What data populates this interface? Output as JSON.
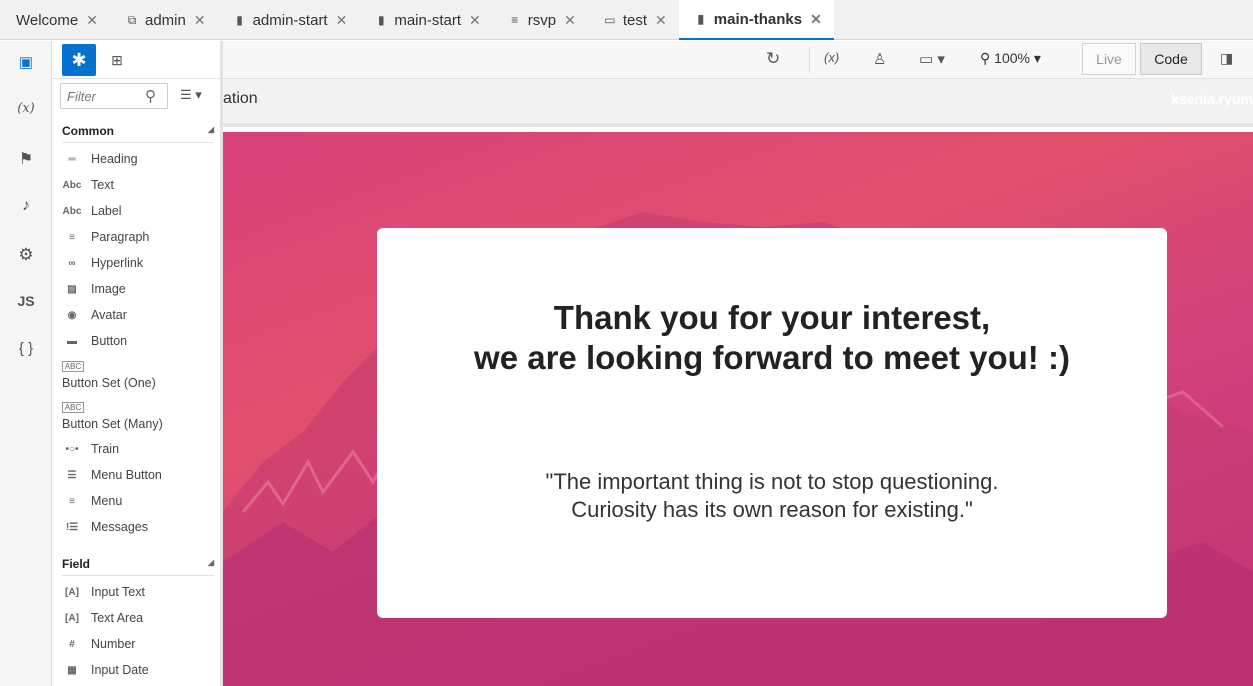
{
  "tabs": [
    {
      "icon": "",
      "label": "Welcome",
      "active": false
    },
    {
      "icon": "copy-icon",
      "label": "admin",
      "active": false
    },
    {
      "icon": "file-icon",
      "label": "admin-start",
      "active": false
    },
    {
      "icon": "file-icon",
      "label": "main-start",
      "active": false
    },
    {
      "icon": "database-icon",
      "label": "rsvp",
      "active": false
    },
    {
      "icon": "monitor-icon",
      "label": "test",
      "active": false
    },
    {
      "icon": "file-icon",
      "label": "main-thanks",
      "active": true
    }
  ],
  "rail": {
    "items": [
      "components-icon",
      "variables-icon",
      "flag-icon",
      "bell-icon",
      "gear-icon",
      "js-icon",
      "json-icon"
    ],
    "variables_glyph": "(x)",
    "js_glyph": "JS",
    "json_glyph": "{ }"
  },
  "palette": {
    "filter_placeholder": "Filter",
    "sections": [
      {
        "title": "Common",
        "items": [
          "Heading",
          "Text",
          "Label",
          "Paragraph",
          "Hyperlink",
          "Image",
          "Avatar",
          "Button",
          "Button Set (One)",
          "Button Set (Many)",
          "Train",
          "Menu Button",
          "Menu",
          "Messages"
        ]
      },
      {
        "title": "Field",
        "items": [
          "Input Text",
          "Text Area",
          "Number",
          "Input Date"
        ]
      }
    ]
  },
  "toolbar": {
    "zoom": "100%",
    "live_label": "Live",
    "code_label": "Code"
  },
  "page_header": {
    "title_fragment": "ation",
    "user_fragment": "ksenia.ryum"
  },
  "card": {
    "heading_line1": "Thank you for your interest,",
    "heading_line2": "we are looking forward to meet you! :)",
    "quote_line1": "\"The important thing is not to stop questioning.",
    "quote_line2": "Curiosity has its own reason for existing.\""
  },
  "colors": {
    "accent": "#0572ce",
    "hero_top": "#e24f6d",
    "hero_bottom": "#c73281"
  }
}
